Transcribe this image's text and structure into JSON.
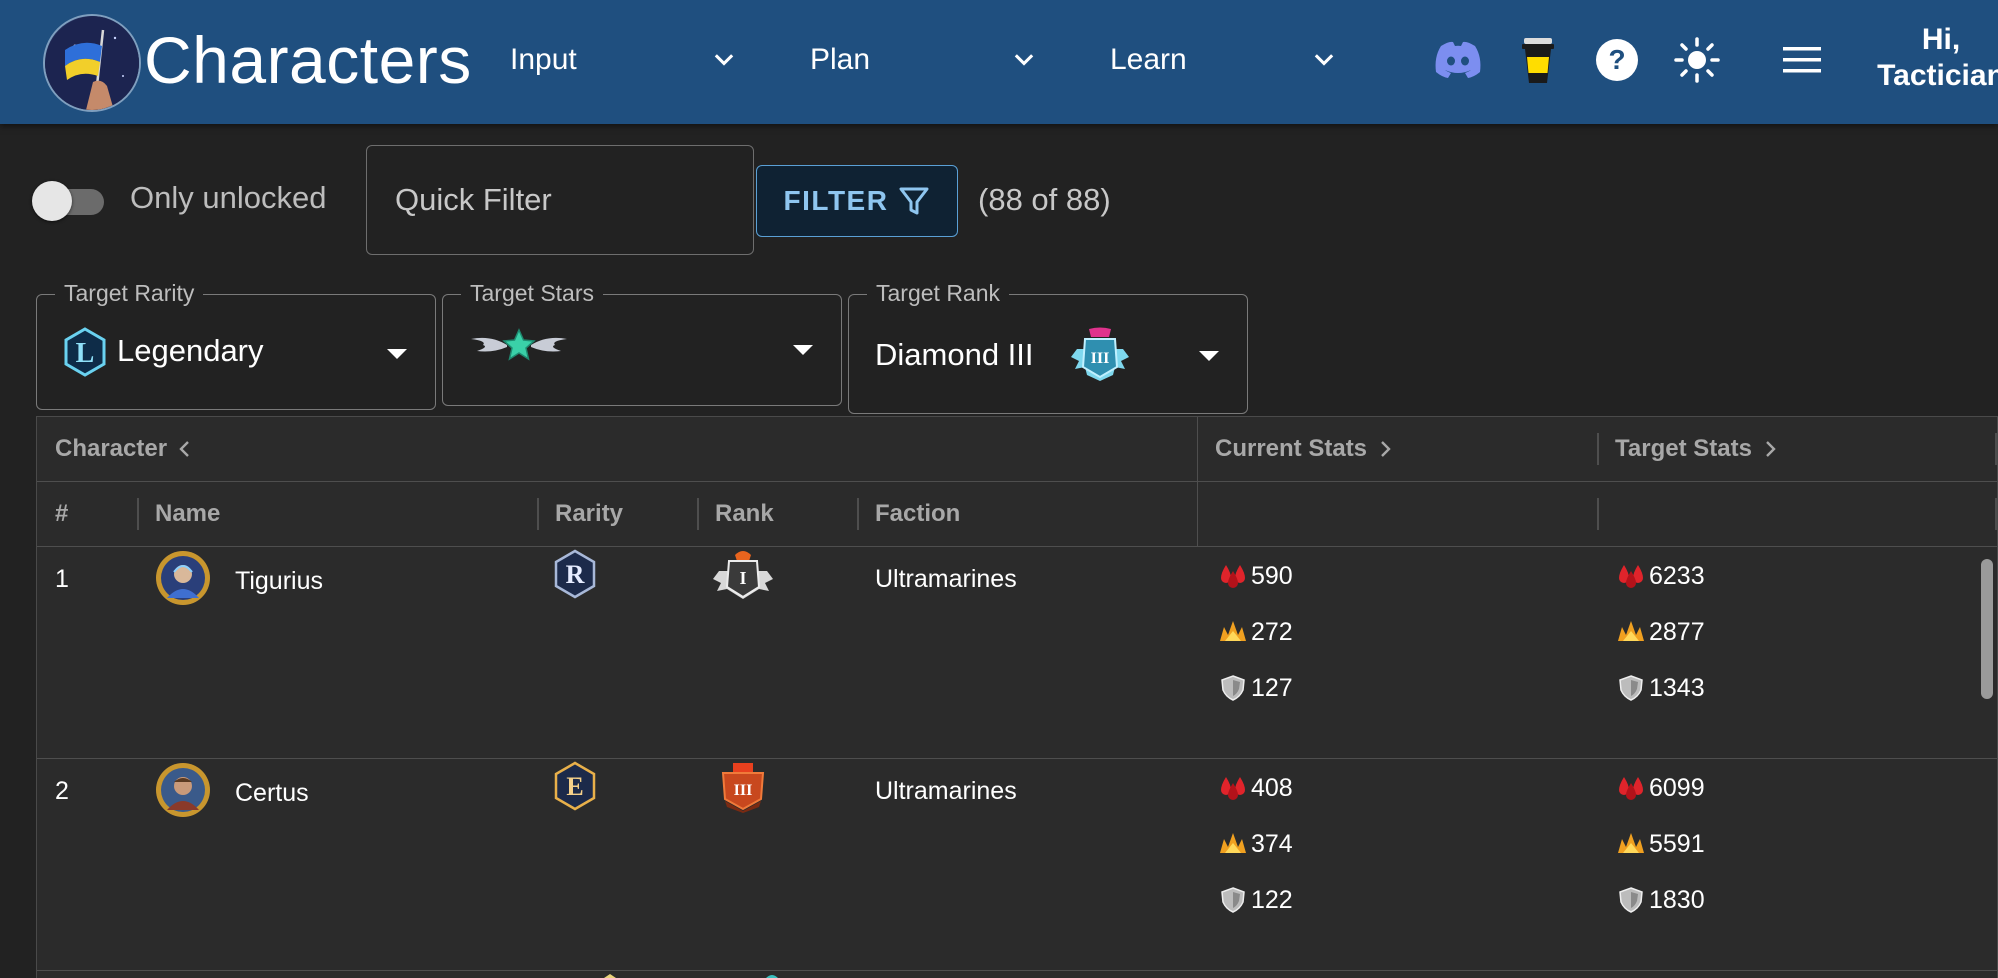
{
  "app": {
    "title": "Characters",
    "greeting_line1": "Hi,",
    "greeting_line2": "Tactician"
  },
  "nav": [
    {
      "label": "Input"
    },
    {
      "label": "Plan"
    },
    {
      "label": "Learn"
    }
  ],
  "icons": [
    "discord-icon",
    "coffee-cup-icon",
    "help-icon",
    "brightness-icon",
    "menu-icon"
  ],
  "filters": {
    "toggle_label": "Only unlocked",
    "toggle_on": false,
    "quick_filter_placeholder": "Quick Filter",
    "filter_button_label": "FILTER",
    "count_text": "(88 of 88)"
  },
  "targets": {
    "rarity": {
      "label": "Target Rarity",
      "value": "Legendary",
      "icon": "legendary-rarity-icon"
    },
    "stars": {
      "label": "Target Stars",
      "value": "",
      "icon": "winged-star-icon"
    },
    "rank": {
      "label": "Target Rank",
      "value": "Diamond III",
      "icon": "diamond-rank-icon"
    }
  },
  "grid": {
    "group_headers": {
      "character": "Character",
      "current_stats": "Current Stats",
      "target_stats": "Target Stats"
    },
    "columns": {
      "index": "#",
      "name": "Name",
      "rarity": "Rarity",
      "rank": "Rank",
      "faction": "Faction"
    },
    "rows": [
      {
        "index": "1",
        "name": "Tigurius",
        "rarity_letter": "R",
        "rank_numeral": "I",
        "faction": "Ultramarines",
        "current": {
          "health": "590",
          "damage": "272",
          "armor": "127"
        },
        "target": {
          "health": "6233",
          "damage": "2877",
          "armor": "1343"
        }
      },
      {
        "index": "2",
        "name": "Certus",
        "rarity_letter": "E",
        "rank_numeral": "III",
        "faction": "Ultramarines",
        "current": {
          "health": "408",
          "damage": "374",
          "armor": "122"
        },
        "target": {
          "health": "6099",
          "damage": "5591",
          "armor": "1830"
        }
      }
    ]
  },
  "colors": {
    "appbar": "#1f4f7f",
    "background": "#222222",
    "accent": "#5aa0d6",
    "health": "#e0242b",
    "damage": "#f0a020"
  }
}
